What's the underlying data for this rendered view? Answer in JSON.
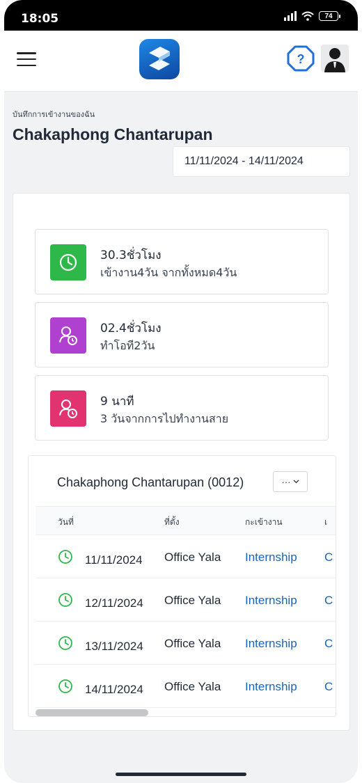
{
  "status_bar": {
    "time": "18:05",
    "battery": "74"
  },
  "header": {
    "menu_icon": "hamburger-menu-icon",
    "logo_icon": "app-logo-icon",
    "help_icon": "help-question-icon",
    "avatar_icon": "user-avatar-icon"
  },
  "page": {
    "breadcrumb": "บันทึกการเข้างานของฉัน",
    "title": "Chakaphong Chantarupan",
    "date_range": "11/11/2024 - 14/11/2024"
  },
  "stats": [
    {
      "value": "30.3ชั่วโมง",
      "desc": "เข้างาน4วัน จากทั้งหมด4วัน",
      "color": "#2eb84a",
      "icon": "clock-icon"
    },
    {
      "value": "02.4ชั่วโมง",
      "desc": "ทำโอที2วัน",
      "color": "#b040d0",
      "icon": "user-clock-icon"
    },
    {
      "value": "9 นาที",
      "desc": "3 วันจากการไปทำงานสาย",
      "color": "#e0336f",
      "icon": "user-clock-icon"
    }
  ],
  "table": {
    "heading": "Chakaphong Chantarupan (0012)",
    "more_label": "···",
    "columns": [
      "วันที่",
      "ที่ตั้ง",
      "กะเข้างาน",
      "เ"
    ],
    "rows": [
      {
        "date": "11/11/2024",
        "location": "Office Yala",
        "shift": "Internship",
        "extra": "C"
      },
      {
        "date": "12/11/2024",
        "location": "Office Yala",
        "shift": "Internship",
        "extra": "C"
      },
      {
        "date": "13/11/2024",
        "location": "Office Yala",
        "shift": "Internship",
        "extra": "C"
      },
      {
        "date": "14/11/2024",
        "location": "Office Yala",
        "shift": "Internship",
        "extra": "C"
      }
    ],
    "row_icon_color": "#2eb84a",
    "link_color": "#1565c0"
  }
}
